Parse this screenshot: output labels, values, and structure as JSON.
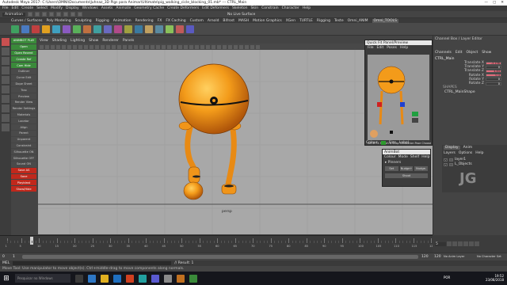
{
  "window": {
    "title": "Autodesk Maya 2017: C:\\Users\\OMNI\\Documents\\Juhnaz_3D Pigs para Animar\\Ultimate\\pig_walking_cicle_blocking_01.mb* --- CTRL_Main",
    "controls": [
      "—",
      "▢",
      "✕"
    ]
  },
  "menubar": [
    "File",
    "Edit",
    "Create",
    "Select",
    "Modify",
    "Display",
    "Windows",
    "Assets",
    "Animate",
    "Geometry Cache",
    "Create Deformers",
    "Edit Deformers",
    "Skeleton",
    "Skin",
    "Constrain",
    "Character",
    "Help"
  ],
  "statusline": {
    "mode": "Animation",
    "surface": "No Live Surface"
  },
  "shelf_tabs": [
    "Curves / Surfaces",
    "Poly Modeling",
    "Sculpting",
    "Rigging",
    "Animation",
    "Rendering",
    "FX",
    "FX Caching",
    "Custom",
    "Arnold",
    "Bifrost",
    "MASH",
    "Motion Graphics",
    "XGen",
    "TURTLE",
    "Rigging",
    "Teste",
    "Omni_ANIM",
    "Omni_TOOLS"
  ],
  "shelf_tabs_active": 18,
  "side_buttons": [
    {
      "label": "ANIMBOT PLAY",
      "style": "grn"
    },
    {
      "label": "Open",
      "style": "grn"
    },
    {
      "label": "Open Recent",
      "style": "grn"
    },
    {
      "label": "Create Ref",
      "style": "grn"
    },
    {
      "label": "Cam Hide",
      "style": "grn"
    },
    {
      "label": "Outliner",
      "style": "dk"
    },
    {
      "label": "Curve Edit",
      "style": "dk"
    },
    {
      "label": "Dope Sheet",
      "style": "dk"
    },
    {
      "label": "Trax",
      "style": "dk"
    },
    {
      "label": "Preview",
      "style": "dk"
    },
    {
      "label": "Render View",
      "style": "dk"
    },
    {
      "label": "Render Settings",
      "style": "dk"
    },
    {
      "label": "Materials",
      "style": "dk"
    },
    {
      "label": "Locator",
      "style": "dk"
    },
    {
      "label": "Align",
      "style": "dk"
    },
    {
      "label": "Parent",
      "style": "dk"
    },
    {
      "label": "Unparent",
      "style": "dk"
    },
    {
      "label": "Constraint",
      "style": "dk"
    },
    {
      "label": "Silhouette ON",
      "style": "dk"
    },
    {
      "label": "Silhouette OFF",
      "style": "dk"
    },
    {
      "label": "Sound ON",
      "style": "dk"
    },
    {
      "label": "Save AS",
      "style": "red"
    },
    {
      "label": "Save",
      "style": "red"
    },
    {
      "label": "Playblast",
      "style": "red"
    },
    {
      "label": "Show/Hide",
      "style": "red"
    }
  ],
  "viewport": {
    "menu": [
      "View",
      "Shading",
      "Lighting",
      "Show",
      "Renderer",
      "Panels"
    ],
    "camera_label": "persp"
  },
  "channel_box": {
    "title": "Channel Box / Layer Editor",
    "tabs": [
      "Channels",
      "Edit",
      "Object",
      "Show"
    ],
    "object": "CTRL_Main",
    "attrs": [
      {
        "name": "Translate X",
        "value": "-3.196",
        "pink": true
      },
      {
        "name": "Translate Y",
        "value": "0",
        "pink": false
      },
      {
        "name": "Translate Z",
        "value": "4.84",
        "pink": true
      },
      {
        "name": "Rotate X",
        "value": "0.4",
        "pink": true
      },
      {
        "name": "Rotate Y",
        "value": "0",
        "pink": false
      },
      {
        "name": "Rotate Z",
        "value": "0",
        "pink": false
      }
    ],
    "shapes_label": "SHAPES",
    "shape_name": "CTRL_MainShape"
  },
  "layers": {
    "tabs": [
      "Display",
      "Anim"
    ],
    "menu": [
      "Layers",
      "Options",
      "Help"
    ],
    "rows": [
      {
        "vis": "V",
        "name": "layer1"
      },
      {
        "vis": "V",
        "name": "L_Objects"
      }
    ]
  },
  "float_panel_1": {
    "title": "Quick Fit Panel/Preview",
    "menu": [
      "File",
      "Edit",
      "Poses",
      "Help"
    ],
    "labels": [
      "Colour",
      "Size",
      "Label"
    ],
    "footer": "Set IK FK Switch & Snap Translation Pose Chooser"
  },
  "float_panel_2": {
    "title": "AnimBot",
    "menu": [
      "Colour",
      "Mode",
      "Shelf",
      "Help"
    ],
    "section": "Pinners",
    "buttons": [
      "Set",
      "Nudge+",
      "Nudge-",
      "Shoot"
    ]
  },
  "timeline": {
    "ticks": [
      "1",
      "5",
      "10",
      "15",
      "20",
      "25",
      "30",
      "35",
      "40",
      "45",
      "50",
      "55",
      "60",
      "65",
      "70",
      "75",
      "80",
      "85",
      "90",
      "95",
      "100",
      "105",
      "110",
      "115",
      "120"
    ],
    "current_frame": "5"
  },
  "range": {
    "start": "0",
    "inner_start": "1",
    "inner_end": "120",
    "end": "120",
    "fps": "No Character Set",
    "anim_layer": "No Anim Layer"
  },
  "commandline": {
    "lang": "MEL",
    "result": "// Result: 1"
  },
  "helpline": "Move Tool: Use manipulator to move object(s). Ctrl+middle-drag to move components along normals.",
  "taskbar": {
    "search": "Pesquisar no Windows",
    "lang": "POR",
    "time": "19:52",
    "date": "23/08/2018"
  },
  "colors": {
    "accent": "#2e77c5",
    "orange_body": "#f39b1a",
    "viewport_bg": "#a8a8a8"
  },
  "watermark": "JG"
}
